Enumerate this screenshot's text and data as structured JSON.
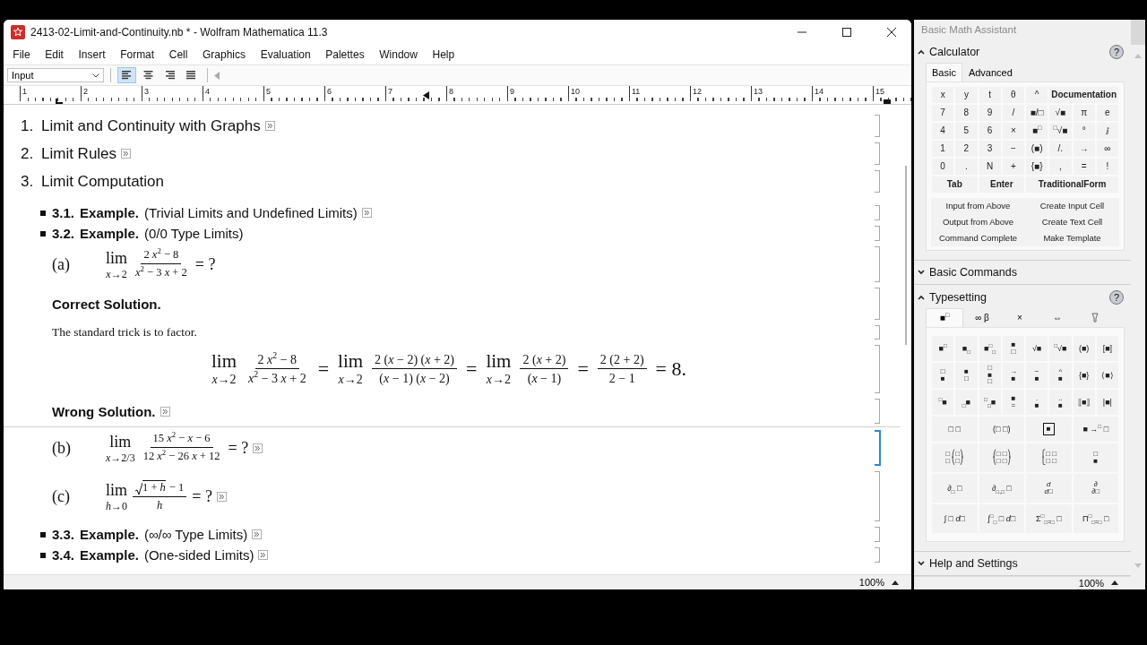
{
  "window": {
    "title": "2413-02-Limit-and-Continuity.nb * - Wolfram Mathematica 11.3"
  },
  "menu": [
    "File",
    "Edit",
    "Insert",
    "Format",
    "Cell",
    "Graphics",
    "Evaluation",
    "Palettes",
    "Window",
    "Help"
  ],
  "toolbar": {
    "style": "Input",
    "align": [
      {
        "kind": "left",
        "selected": true
      },
      {
        "kind": "center",
        "selected": false
      },
      {
        "kind": "right",
        "selected": false
      },
      {
        "kind": "justify",
        "selected": false
      }
    ]
  },
  "ruler": [
    "1",
    "2",
    "3",
    "4",
    "5",
    "6",
    "7",
    "8",
    "9",
    "10",
    "11",
    "12",
    "13",
    "14",
    "15"
  ],
  "cells": [
    {
      "kind": "section",
      "number": "1.",
      "title": "Limit and Continuity with Graphs",
      "closed": true,
      "selected": false
    },
    {
      "kind": "section",
      "number": "2.",
      "title": "Limit Rules",
      "closed": true,
      "selected": false
    },
    {
      "kind": "section",
      "number": "3.",
      "title": "Limit Computation",
      "closed": false,
      "selected": false
    },
    {
      "kind": "subsection",
      "number": "3.1.",
      "label": "Example.",
      "title": "(Trivial Limits and Undefined Limits)",
      "closed": true,
      "selected": false
    },
    {
      "kind": "subsection",
      "number": "3.2.",
      "label": "Example.",
      "title": "(0/0 Type Limits)",
      "closed": false,
      "selected": false
    },
    {
      "kind": "problem",
      "label": "(a)",
      "closed": false,
      "selected": false,
      "formula": [
        {
          "kind": "lim",
          "text": "lim",
          "under": "*x*→2"
        },
        {
          "kind": "frac",
          "num": "2 *x*$^{2}$ − 8",
          "den": "*x*$^{2}$ − 3 *x* + 2"
        },
        {
          "kind": "text",
          "text": "= ?"
        }
      ]
    },
    {
      "kind": "heading",
      "text": "Correct Solution.",
      "closed": false,
      "selected": false
    },
    {
      "kind": "text",
      "text": "The standard trick is to factor.",
      "selected": false
    },
    {
      "kind": "display",
      "selected": false,
      "formula": [
        {
          "kind": "lim",
          "text": "lim",
          "under": "*x*→2"
        },
        {
          "kind": "frac",
          "num": "2 *x*$^{2}$ − 8",
          "den": "*x*$^{2}$ − 3 *x* + 2"
        },
        {
          "kind": "text",
          "text": "="
        },
        {
          "kind": "lim",
          "text": "lim",
          "under": "*x*→2"
        },
        {
          "kind": "frac",
          "num": "2 (*x* − 2) (*x* + 2)",
          "den": "(*x* − 1) (*x* − 2)"
        },
        {
          "kind": "text",
          "text": "="
        },
        {
          "kind": "lim",
          "text": "lim",
          "under": "*x*→2"
        },
        {
          "kind": "frac",
          "num": "2 (*x* + 2)",
          "den": "(*x* − 1)"
        },
        {
          "kind": "text",
          "text": "="
        },
        {
          "kind": "frac",
          "num": "2 (2 + 2)",
          "den": "2 − 1"
        },
        {
          "kind": "text",
          "text": "= 8."
        }
      ]
    },
    {
      "kind": "heading",
      "text": "Wrong Solution.",
      "closed": true,
      "selected": false
    },
    {
      "kind": "insertion_point",
      "selected": false
    },
    {
      "kind": "problem",
      "label": "(b)",
      "closed": true,
      "selected": true,
      "formula": [
        {
          "kind": "lim",
          "text": "lim",
          "under": "*x*→2/3"
        },
        {
          "kind": "frac",
          "num": "15 *x*$^{2}$ − *x* − 6",
          "den": "12 *x*$^{2}$ − 26 *x* + 12"
        },
        {
          "kind": "text",
          "text": "= ?"
        }
      ]
    },
    {
      "kind": "problem",
      "label": "(c)",
      "closed": true,
      "selected": false,
      "formula": [
        {
          "kind": "lim",
          "text": "lim",
          "under": "*h*→0"
        },
        {
          "kind": "frac",
          "root": "1 + *h*",
          "num": "− 1",
          "den": "*h*"
        },
        {
          "kind": "text",
          "text": "= ?"
        }
      ]
    },
    {
      "kind": "subsection",
      "number": "3.3.",
      "label": "Example.",
      "title": "(∞/∞ Type Limits)",
      "closed": true,
      "selected": false
    },
    {
      "kind": "subsection",
      "number": "3.4.",
      "label": "Example.",
      "title": "(One-sided Limits)",
      "closed": true,
      "selected": false
    }
  ],
  "status_bar": {
    "zoom": "100%"
  },
  "palette": {
    "title": "Basic Math Assistant",
    "zoom": "100%",
    "sections": [
      {
        "kind": "calculator",
        "title": "Calculator",
        "expanded": true,
        "help": "?",
        "tabs": [
          {
            "label": "Basic",
            "selected": true
          },
          {
            "label": "Advanced",
            "selected": false
          }
        ],
        "rows": [
          [
            "x",
            "y",
            "t",
            "θ",
            "^",
            "Documentation"
          ],
          [
            "7",
            "8",
            "9",
            "/",
            "■/□",
            "√■",
            "π",
            "e"
          ],
          [
            "4",
            "5",
            "6",
            "×",
            "■$^{□}$",
            "$^{□}$√■",
            "°",
            "ⅈ"
          ],
          [
            "1",
            "2",
            "3",
            "−",
            "(■)",
            "/.",
            "→",
            "∞"
          ],
          [
            "0",
            ".",
            "N",
            "+",
            "{■}",
            ",",
            "=",
            "!"
          ]
        ],
        "controls": [
          "Tab",
          "Enter",
          "TraditionalForm"
        ],
        "commands": [
          "Input from Above",
          "Create Input Cell",
          "Output from Above",
          "Create Text Cell",
          "Command Complete",
          "Make Template"
        ]
      },
      {
        "kind": "collapsed",
        "title": "Basic Commands",
        "expanded": false
      },
      {
        "kind": "typesetting",
        "title": "Typesetting",
        "expanded": true,
        "help": "?",
        "tabs": [
          {
            "kind": "text",
            "label": "■$^{□}$",
            "selected": true
          },
          {
            "kind": "text",
            "label": "∞ β",
            "selected": false
          },
          {
            "kind": "text",
            "label": "×",
            "selected": false
          },
          {
            "kind": "text",
            "label": "⇔",
            "selected": false
          },
          {
            "kind": "icon",
            "selected": false
          }
        ],
        "rows": [
          [
            "■$^{□}$",
            "■$_{□}$",
            "■$^{□}$$_{□}$",
            {
              "kind": "stack",
              "parts": [
                "■",
                "□"
              ]
            },
            "√■",
            "$^{□}$√■",
            "(■)",
            "[■]"
          ],
          [
            {
              "kind": "stack",
              "parts": [
                "□",
                "■"
              ]
            },
            {
              "kind": "stack",
              "parts": [
                "■",
                "□"
              ]
            },
            {
              "kind": "stack",
              "parts": [
                "□",
                "■",
                "□"
              ]
            },
            {
              "kind": "stack",
              "parts": [
                "→",
                "■"
              ]
            },
            {
              "kind": "stack",
              "parts": [
                "−",
                "■"
              ]
            },
            {
              "kind": "stack",
              "parts": [
                "^",
                "■"
              ]
            },
            "{■}",
            "⟨■⟩"
          ],
          [
            "$^{□}$■",
            "$_{□}$■",
            "$^{□}$$_{□}$■",
            {
              "kind": "stack",
              "parts": [
                "■",
                "="
              ]
            },
            {
              "kind": "stack",
              "parts": [
                ".",
                "■"
              ]
            },
            {
              "kind": "stack",
              "parts": [
                "..",
                "■"
              ]
            },
            "⟦■⟧",
            "|■|"
          ],
          [
            "□ □",
            "(□ □)",
            {
              "kind": "box",
              "text": "■"
            },
            "■ →$^{□}$ □"
          ],
          [
            {
              "kind": "stack",
              "parts": [
                "□ ⎛□⎞",
                "□ ⎝□⎠"
              ]
            },
            {
              "kind": "stack",
              "parts": [
                "⎛□ □⎞",
                "⎝□ □⎠"
              ]
            },
            {
              "kind": "stack",
              "parts": [
                "⎧□ □",
                "⎩□ □"
              ]
            },
            {
              "kind": "stack",
              "parts": [
                "□",
                "■"
              ]
            }
          ],
          [
            "∂$_{□}$ □",
            "∂$_{□,□}$ □",
            {
              "kind": "stack",
              "parts": [
                "*d*",
                "*d*□"
              ]
            },
            {
              "kind": "stack",
              "parts": [
                "∂",
                "∂□"
              ]
            }
          ],
          [
            "∫ □ *d*□",
            "∫$^{□}$$_{□}$ □ *d*□",
            "Σ$^{□}$$_{□=□}$ □",
            "Π$^{□}$$_{□=□}$ □"
          ]
        ]
      },
      {
        "kind": "collapsed",
        "title": "Help and Settings",
        "expanded": false
      }
    ]
  }
}
